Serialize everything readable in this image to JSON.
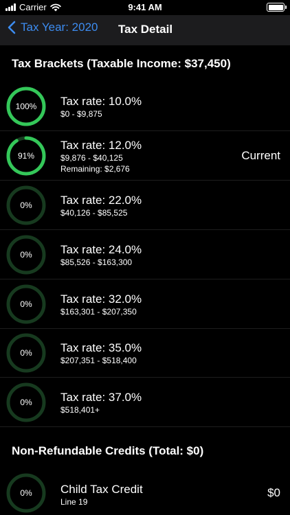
{
  "status_bar": {
    "carrier": "Carrier",
    "time": "9:41 AM"
  },
  "nav": {
    "back_label": "Tax Year: 2020",
    "title": "Tax Detail"
  },
  "brackets_section": {
    "title": "Tax Brackets (Taxable Income: $37,450)",
    "items": [
      {
        "progress_label": "100%",
        "progress": 1.0,
        "rate": "Tax rate: 10.0%",
        "range": "$0 - $9,875",
        "remaining": "",
        "status": ""
      },
      {
        "progress_label": "91%",
        "progress": 0.91,
        "rate": "Tax rate: 12.0%",
        "range": "$9,876 - $40,125",
        "remaining": "Remaining: $2,676",
        "status": "Current"
      },
      {
        "progress_label": "0%",
        "progress": 0,
        "rate": "Tax rate: 22.0%",
        "range": "$40,126 - $85,525",
        "remaining": "",
        "status": ""
      },
      {
        "progress_label": "0%",
        "progress": 0,
        "rate": "Tax rate: 24.0%",
        "range": "$85,526 - $163,300",
        "remaining": "",
        "status": ""
      },
      {
        "progress_label": "0%",
        "progress": 0,
        "rate": "Tax rate: 32.0%",
        "range": "$163,301 - $207,350",
        "remaining": "",
        "status": ""
      },
      {
        "progress_label": "0%",
        "progress": 0,
        "rate": "Tax rate: 35.0%",
        "range": "$207,351 - $518,400",
        "remaining": "",
        "status": ""
      },
      {
        "progress_label": "0%",
        "progress": 0,
        "rate": "Tax rate: 37.0%",
        "range": "$518,401+",
        "remaining": "",
        "status": ""
      }
    ]
  },
  "credits_section": {
    "title": "Non-Refundable Credits (Total: $0)",
    "items": [
      {
        "progress_label": "0%",
        "progress": 0,
        "name": "Child Tax Credit",
        "line": "Line 19",
        "amount": "$0"
      }
    ]
  },
  "colors": {
    "accent": "#3d8cf0",
    "ring_active": "#34c759",
    "ring_track": "#173a1f",
    "nav_bg": "#1c1c1e"
  }
}
